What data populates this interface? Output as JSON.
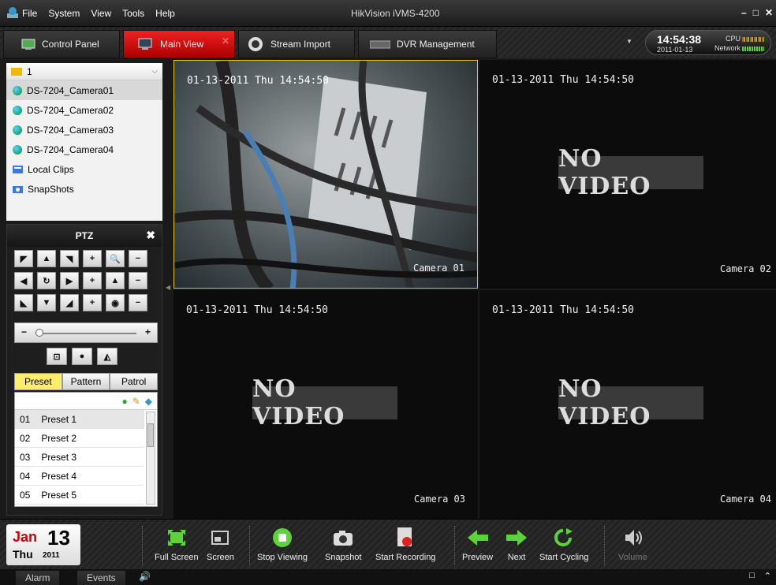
{
  "titlebar": {
    "menu": [
      "File",
      "System",
      "View",
      "Tools",
      "Help"
    ],
    "title": "HikVision iVMS-4200"
  },
  "tabs": [
    {
      "label": "Control Panel",
      "icon": "control-panel-icon"
    },
    {
      "label": "Main View",
      "icon": "main-view-icon",
      "active": true
    },
    {
      "label": "Stream Import",
      "icon": "stream-import-icon"
    },
    {
      "label": "DVR Management",
      "icon": "dvr-icon"
    }
  ],
  "status": {
    "time": "14:54:38",
    "date": "2011-01-13",
    "cpu_label": "CPU",
    "network_label": "Network"
  },
  "tree": {
    "group": "1",
    "items": [
      {
        "label": "DS-7204_Camera01",
        "icon": "camera-icon",
        "selected": true
      },
      {
        "label": "DS-7204_Camera02",
        "icon": "camera-icon"
      },
      {
        "label": "DS-7204_Camera03",
        "icon": "camera-icon"
      },
      {
        "label": "DS-7204_Camera04",
        "icon": "camera-icon"
      },
      {
        "label": "Local Clips",
        "icon": "local-clips-icon"
      },
      {
        "label": "SnapShots",
        "icon": "snapshots-icon"
      }
    ]
  },
  "ptz": {
    "title": "PTZ",
    "tabs": [
      "Preset",
      "Pattern",
      "Patrol"
    ],
    "active_tab": "Preset",
    "presets": [
      {
        "num": "01",
        "name": "Preset 1"
      },
      {
        "num": "02",
        "name": "Preset 2"
      },
      {
        "num": "03",
        "name": "Preset 3"
      },
      {
        "num": "04",
        "name": "Preset 4"
      },
      {
        "num": "05",
        "name": "Preset 5"
      }
    ]
  },
  "videos": [
    {
      "stamp": "01-13-2011 Thu 14:54:50",
      "camera": "Camera 01",
      "novideo": ""
    },
    {
      "stamp": "01-13-2011 Thu 14:54:50",
      "camera": "Camera 02",
      "novideo": "NO VIDEO"
    },
    {
      "stamp": "01-13-2011 Thu 14:54:50",
      "camera": "Camera 03",
      "novideo": "NO VIDEO"
    },
    {
      "stamp": "01-13-2011 Thu 14:54:50",
      "camera": "Camera 04",
      "novideo": "NO VIDEO"
    }
  ],
  "calendar": {
    "month": "Jan",
    "day": "13",
    "weekday": "Thu",
    "year": "2011"
  },
  "toolbar": {
    "full_screen": "Full Screen",
    "screen": "Screen",
    "stop_viewing": "Stop Viewing",
    "snapshot": "Snapshot",
    "start_recording": "Start Recording",
    "preview": "Preview",
    "next": "Next",
    "start_cycling": "Start Cycling",
    "volume": "Volume"
  },
  "statusbar": {
    "alarm": "Alarm",
    "events": "Events"
  },
  "colors": {
    "accent_red": "#cc1111",
    "active_tile_border": "#e0c41a",
    "preset_tab_active": "#ffec6b",
    "arrow_green": "#5ed23a"
  }
}
